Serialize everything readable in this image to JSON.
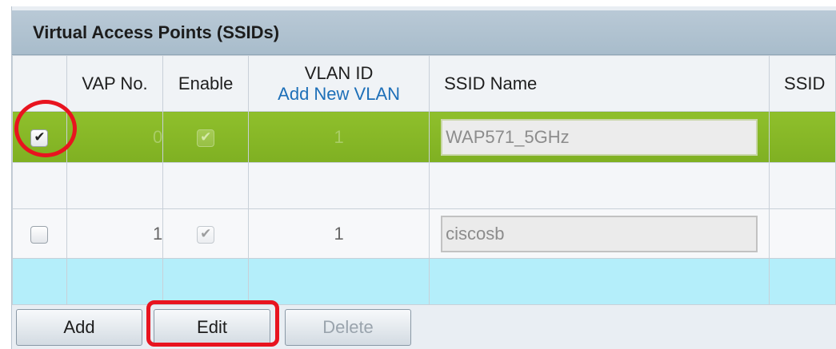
{
  "panel": {
    "title": "Virtual Access Points (SSIDs)"
  },
  "columns": {
    "vap_no": "VAP No.",
    "enable": "Enable",
    "vlan_id": "VLAN ID",
    "vlan_link": "Add New VLAN",
    "ssid_name": "SSID Name",
    "ssid_more": "SSID"
  },
  "rows": [
    {
      "selected": true,
      "vap_no": "0",
      "enable": true,
      "vlan_id": "1",
      "ssid_name": "WAP571_5GHz"
    },
    {
      "selected": false,
      "vap_no": "1",
      "enable": true,
      "vlan_id": "1",
      "ssid_name": "ciscosb"
    }
  ],
  "buttons": {
    "add": "Add",
    "edit": "Edit",
    "delete": "Delete"
  },
  "colors": {
    "selected_row": "#8fbf2c",
    "highlight": "#e8141f",
    "link": "#1d6fb8"
  }
}
